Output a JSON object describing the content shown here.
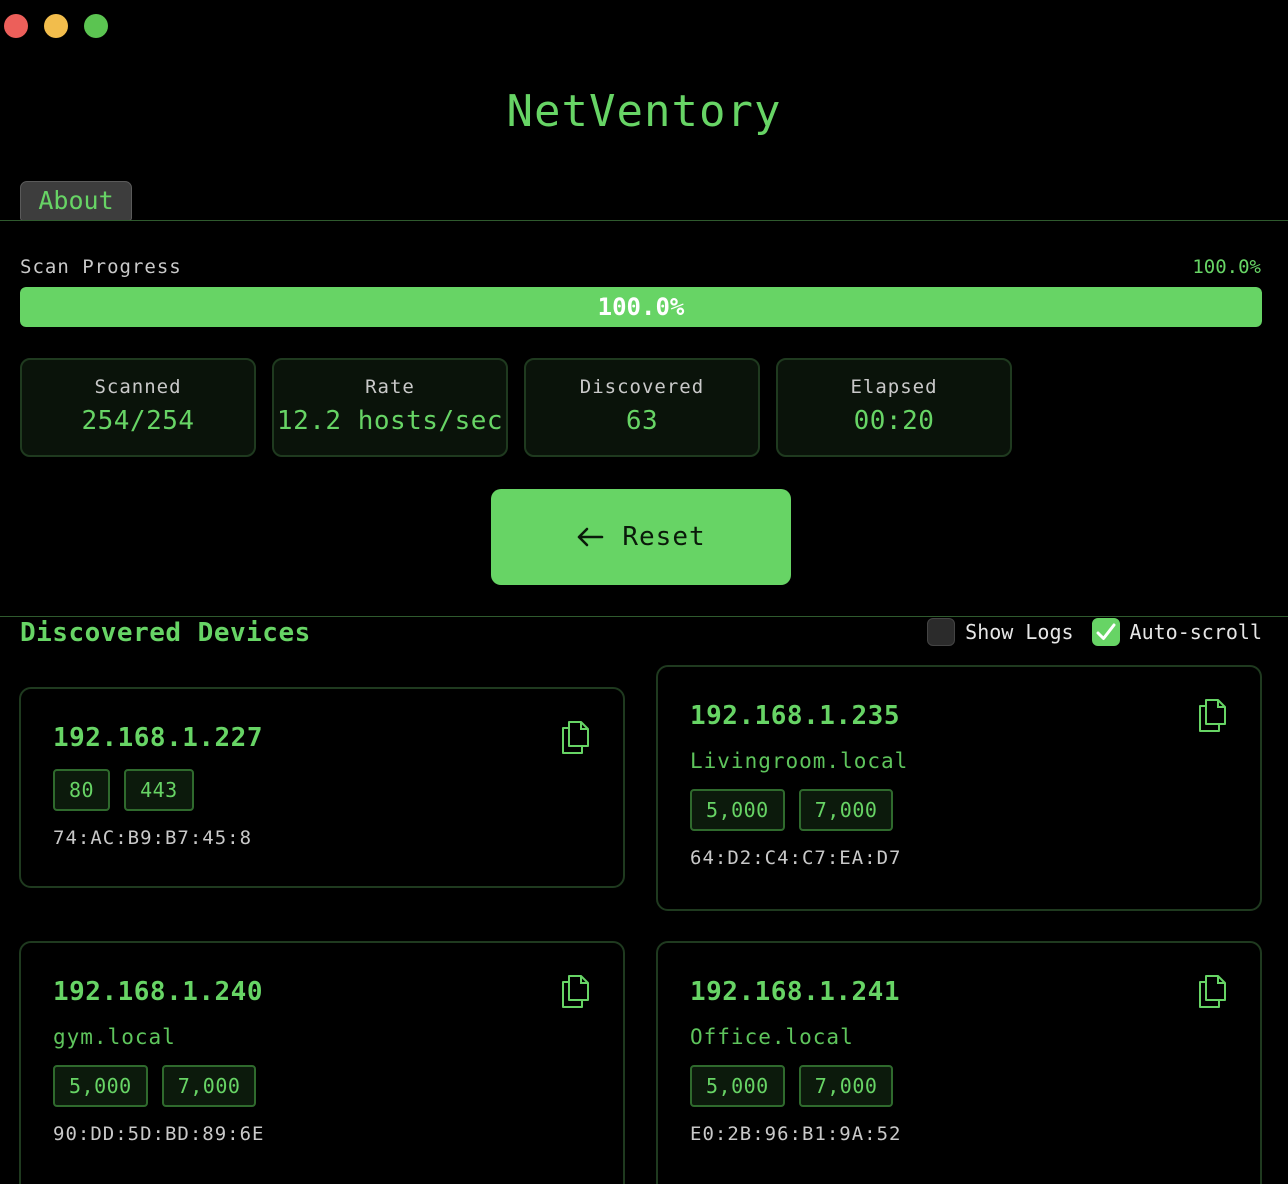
{
  "app": {
    "title": "NetVentory"
  },
  "tabs": {
    "about": "About"
  },
  "progress": {
    "label": "Scan Progress",
    "percent_text": "100.0%",
    "bar_text": "100.0%",
    "fraction": 1.0
  },
  "stats": [
    {
      "label": "Scanned",
      "value": "254/254"
    },
    {
      "label": "Rate",
      "value": "12.2 hosts/sec"
    },
    {
      "label": "Discovered",
      "value": "63"
    },
    {
      "label": "Elapsed",
      "value": "00:20"
    }
  ],
  "reset_button": {
    "label": "Reset",
    "icon": "arrow-left-icon"
  },
  "devices_section": {
    "title": "Discovered Devices",
    "show_logs": {
      "label": "Show Logs",
      "checked": false
    },
    "auto_scroll": {
      "label": "Auto-scroll",
      "checked": true
    }
  },
  "devices": [
    {
      "ip": "192.168.1.227",
      "hostname": "",
      "ports": [
        "80",
        "443"
      ],
      "mac": "74:AC:B9:B7:45:8"
    },
    {
      "ip": "192.168.1.235",
      "hostname": "Livingroom.local",
      "ports": [
        "5,000",
        "7,000"
      ],
      "mac": "64:D2:C4:C7:EA:D7"
    },
    {
      "ip": "192.168.1.240",
      "hostname": "gym.local",
      "ports": [
        "5,000",
        "7,000"
      ],
      "mac": "90:DD:5D:BD:89:6E"
    },
    {
      "ip": "192.168.1.241",
      "hostname": "Office.local",
      "ports": [
        "5,000",
        "7,000"
      ],
      "mac": "E0:2B:96:B1:9A:52"
    }
  ],
  "colors": {
    "accent": "#67d465",
    "background": "#000000",
    "muted_text": "#c9c9c9"
  }
}
